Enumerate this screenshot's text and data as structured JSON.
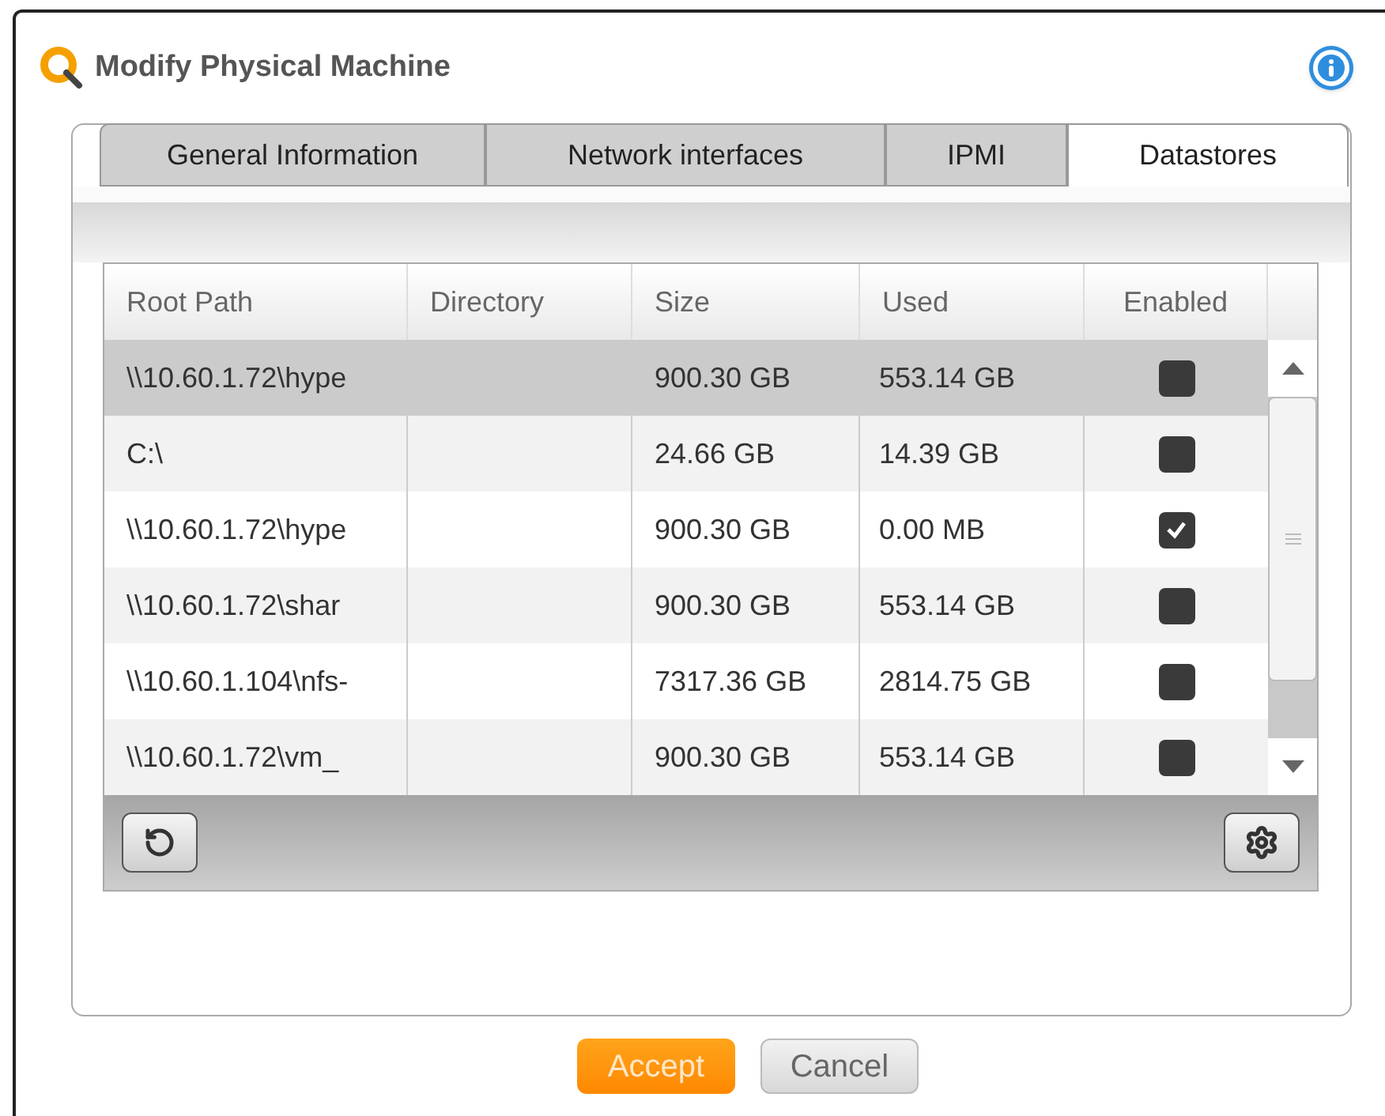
{
  "dialog": {
    "title": "Modify Physical Machine"
  },
  "tabs": [
    {
      "label": "General Information",
      "selected": false
    },
    {
      "label": "Network interfaces",
      "selected": false
    },
    {
      "label": "IPMI",
      "selected": false
    },
    {
      "label": "Datastores",
      "selected": true
    }
  ],
  "table": {
    "columns": [
      "Root Path",
      "Directory",
      "Size",
      "Used",
      "Enabled"
    ],
    "rows": [
      {
        "root_path": "\\\\10.60.1.72\\hype",
        "size": "900.30 GB",
        "used": "553.14 GB",
        "enabled": false,
        "selected": true
      },
      {
        "root_path": "C:\\",
        "size": "24.66 GB",
        "used": "14.39 GB",
        "enabled": false,
        "selected": false
      },
      {
        "root_path": "\\\\10.60.1.72\\hype",
        "size": "900.30 GB",
        "used": "0.00 MB",
        "enabled": true,
        "selected": false
      },
      {
        "root_path": "\\\\10.60.1.72\\shar",
        "size": "900.30 GB",
        "used": "553.14 GB",
        "enabled": false,
        "selected": false
      },
      {
        "root_path": "\\\\10.60.1.104\\nfs-",
        "size": "7317.36 GB",
        "used": "2814.75 GB",
        "enabled": false,
        "selected": false
      },
      {
        "root_path": "\\\\10.60.1.72\\vm_",
        "size": "900.30 GB",
        "used": "553.14 GB",
        "enabled": false,
        "selected": false
      }
    ]
  },
  "buttons": [
    {
      "label": "Accept",
      "kind": "primary"
    },
    {
      "label": "Cancel",
      "kind": "secondary"
    }
  ]
}
